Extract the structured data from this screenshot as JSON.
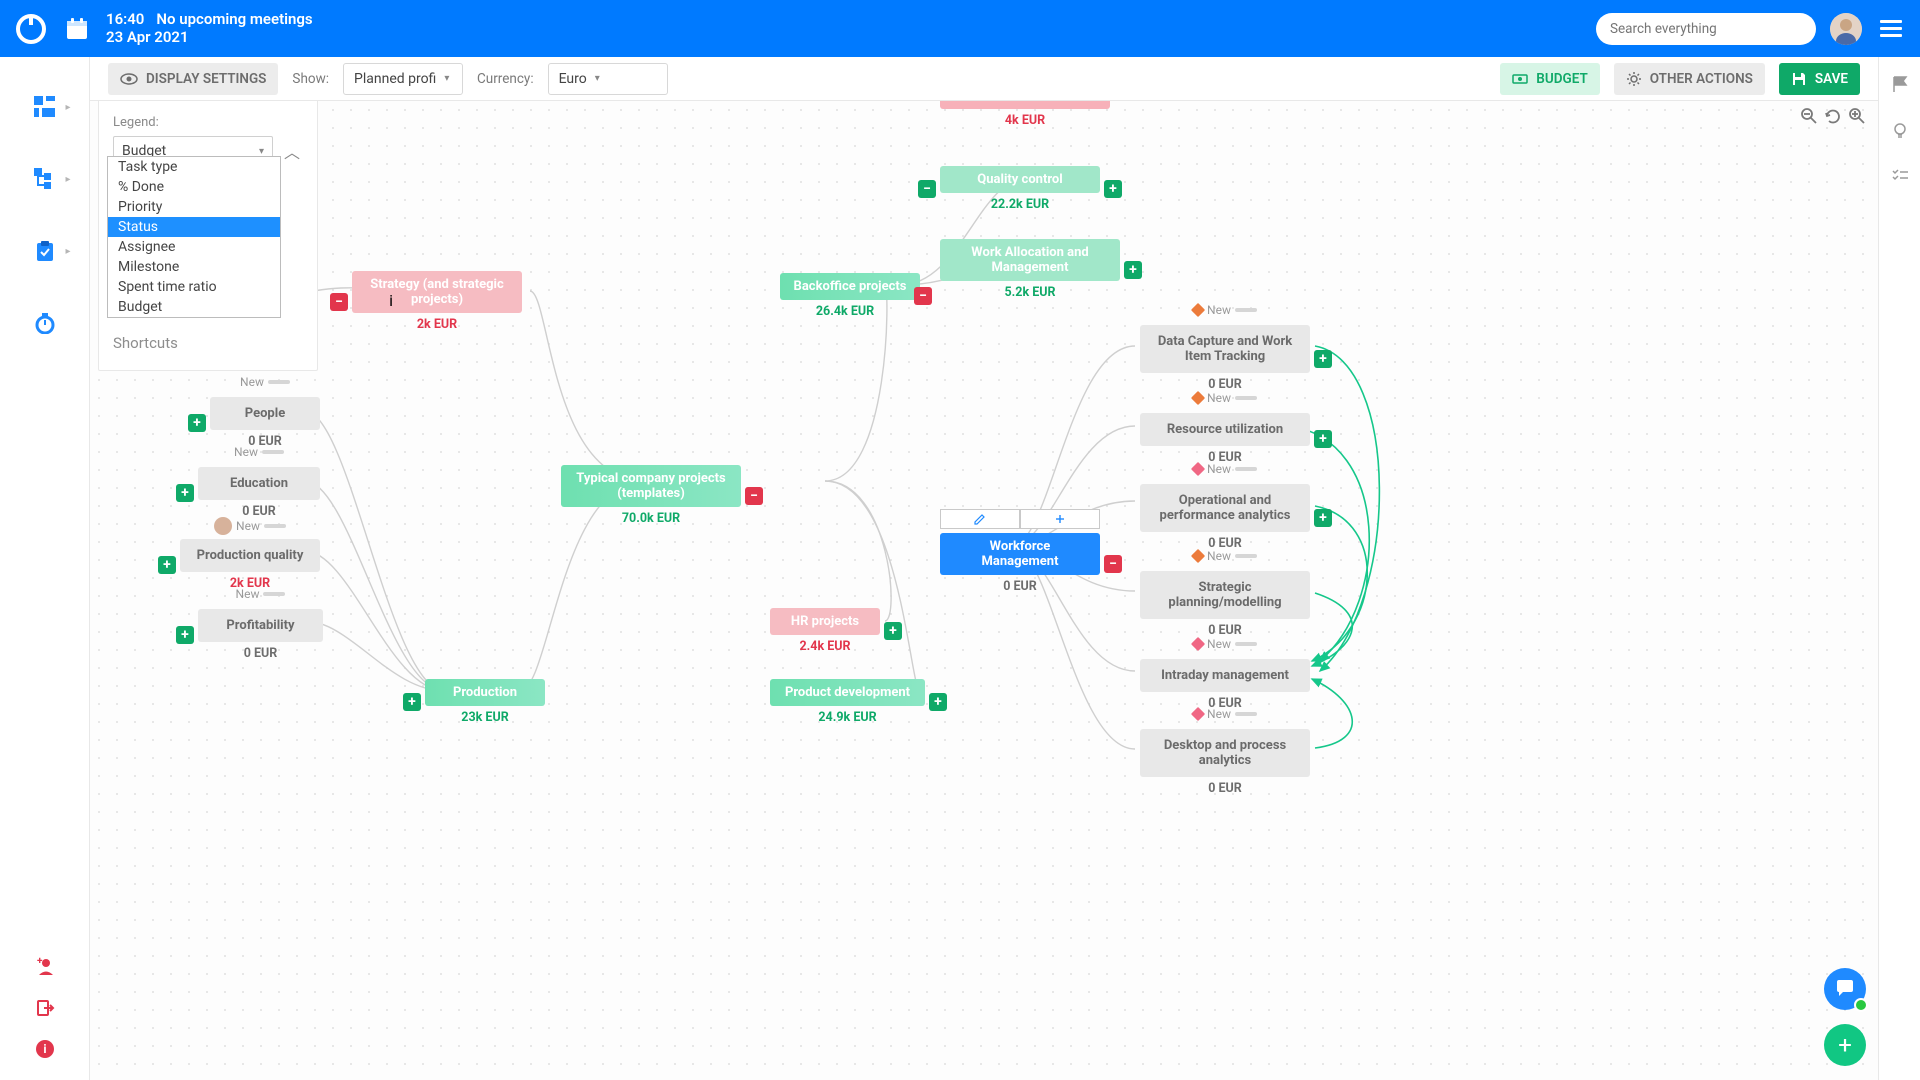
{
  "header": {
    "time": "16:40",
    "meetings": "No upcoming meetings",
    "date": "23 Apr 2021",
    "search_placeholder": "Search everything"
  },
  "toolbar": {
    "display_settings": "DISPLAY SETTINGS",
    "show_label": "Show:",
    "show_value": "Planned profi",
    "currency_label": "Currency:",
    "currency_value": "Euro",
    "budget_btn": "BUDGET",
    "other_actions_btn": "OTHER ACTIONS",
    "save_btn": "SAVE"
  },
  "settings_panel": {
    "legend_label": "Legend:",
    "legend_value": "Budget",
    "shortcuts_label": "Shortcuts"
  },
  "legend_options": [
    "Task type",
    "% Done",
    "Priority",
    "Status",
    "Assignee",
    "Milestone",
    "Spent time ratio",
    "Budget"
  ],
  "legend_selected": "Status",
  "nodes": {
    "top_cut": {
      "sub": "4k EUR"
    },
    "quality_control": {
      "title": "Quality control",
      "sub": "22.2k EUR"
    },
    "work_alloc": {
      "title": "Work Allocation and Management",
      "sub": "5.2k EUR"
    },
    "strategy": {
      "title": "Strategy (and strategic projects)",
      "sub": "2k EUR"
    },
    "backoffice": {
      "title": "Backoffice projects",
      "sub": "26.4k EUR"
    },
    "center": {
      "title": "Typical company projects (templates)",
      "sub": "70.0k EUR"
    },
    "workforce": {
      "title": "Workforce Management",
      "sub": "0 EUR"
    },
    "data_capture": {
      "title": "Data Capture and Work Item Tracking",
      "sub": "0 EUR"
    },
    "resource_util": {
      "title": "Resource utilization",
      "sub": "0 EUR"
    },
    "op_perf": {
      "title": "Operational and performance analytics",
      "sub": "0 EUR"
    },
    "strat_plan": {
      "title": "Strategic planning/modelling",
      "sub": "0 EUR"
    },
    "intraday": {
      "title": "Intraday management",
      "sub": "0 EUR"
    },
    "desktop": {
      "title": "Desktop and process analytics",
      "sub": "0 EUR"
    },
    "people": {
      "title": "People",
      "sub": "0 EUR",
      "status": "New"
    },
    "education": {
      "title": "Education",
      "sub": "0 EUR",
      "status": "New"
    },
    "prod_quality": {
      "title": "Production quality",
      "sub": "2k EUR",
      "status": "New"
    },
    "profitability": {
      "title": "Profitability",
      "sub": "0 EUR",
      "status": "New"
    },
    "production": {
      "title": "Production",
      "sub": "23k EUR"
    },
    "hr": {
      "title": "HR projects",
      "sub": "2.4k EUR"
    },
    "product_dev": {
      "title": "Product development",
      "sub": "24.9k EUR"
    },
    "status_new": "New"
  }
}
